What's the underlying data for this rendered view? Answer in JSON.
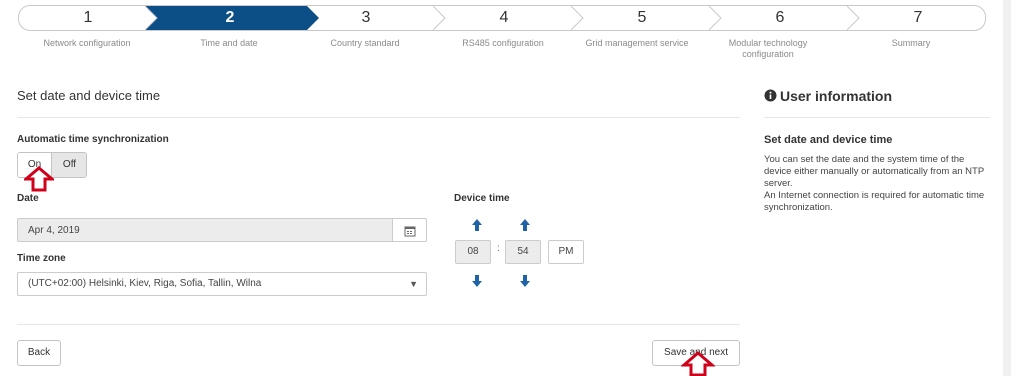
{
  "wizard": {
    "steps": [
      {
        "number": "1",
        "label": "Network configuration"
      },
      {
        "number": "2",
        "label": "Time and date"
      },
      {
        "number": "3",
        "label": "Country standard"
      },
      {
        "number": "4",
        "label": "RS485 configuration"
      },
      {
        "number": "5",
        "label": "Grid management service"
      },
      {
        "number": "6",
        "label": "Modular technology configuration"
      },
      {
        "number": "7",
        "label": "Summary"
      }
    ],
    "active_step": 2,
    "active_color": "#0b4f86"
  },
  "form": {
    "title": "Set date and device time",
    "auto_sync": {
      "label": "Automatic time synchronization",
      "on_label": "On",
      "off_label": "Off",
      "selected": "On"
    },
    "date": {
      "label": "Date",
      "value": "Apr 4, 2019",
      "picker_icon": "calendar-icon"
    },
    "timezone": {
      "label": "Time zone",
      "value": "(UTC+02:00) Helsinki, Kiev, Riga, Sofia, Tallin, Wilna"
    },
    "device_time": {
      "label": "Device time",
      "hour": "08",
      "minute": "54",
      "separator": ":",
      "ampm": "PM"
    }
  },
  "buttons": {
    "back": "Back",
    "save_next": "Save and next"
  },
  "info": {
    "icon": "info-circle-icon",
    "title": "User information",
    "subtitle": "Set date and device time",
    "text": "You can set the date and the system time of the device either manually or automatically from an NTP server.\nAn Internet connection is required for automatic time synchronization."
  },
  "annotation_color": "#d0021b"
}
